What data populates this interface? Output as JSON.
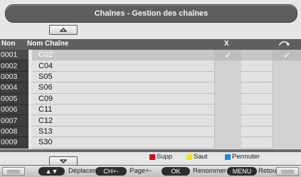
{
  "title": "Chaînes - Gestion des chaînes",
  "columns": {
    "num": "Non",
    "name": "Nom Chaîne",
    "skip": "X",
    "swap_icon": "swap-arrow-icon"
  },
  "check_mark": "✓",
  "rows": [
    {
      "num": "0001",
      "name": "C02",
      "selected": true
    },
    {
      "num": "0002",
      "name": "C04"
    },
    {
      "num": "0003",
      "name": "S05"
    },
    {
      "num": "0004",
      "name": "S06"
    },
    {
      "num": "0005",
      "name": "C09"
    },
    {
      "num": "0006",
      "name": "C11"
    },
    {
      "num": "0007",
      "name": "C12"
    },
    {
      "num": "0008",
      "name": "S13"
    },
    {
      "num": "0009",
      "name": "S30"
    }
  ],
  "legend": {
    "delete": {
      "label": "Supp",
      "color": "#e0001b"
    },
    "skip": {
      "label": "Saut",
      "color": "#f5e600"
    },
    "swap": {
      "label": "Permuter",
      "color": "#1e88e5"
    }
  },
  "hints": {
    "arrows_key": "▲▼",
    "move": "Déplacer",
    "ch_key": "CH+-",
    "page": "Page+-",
    "ok_key": "OK",
    "rename": "Renommer",
    "menu_key": "MENU",
    "back": "Retour"
  }
}
